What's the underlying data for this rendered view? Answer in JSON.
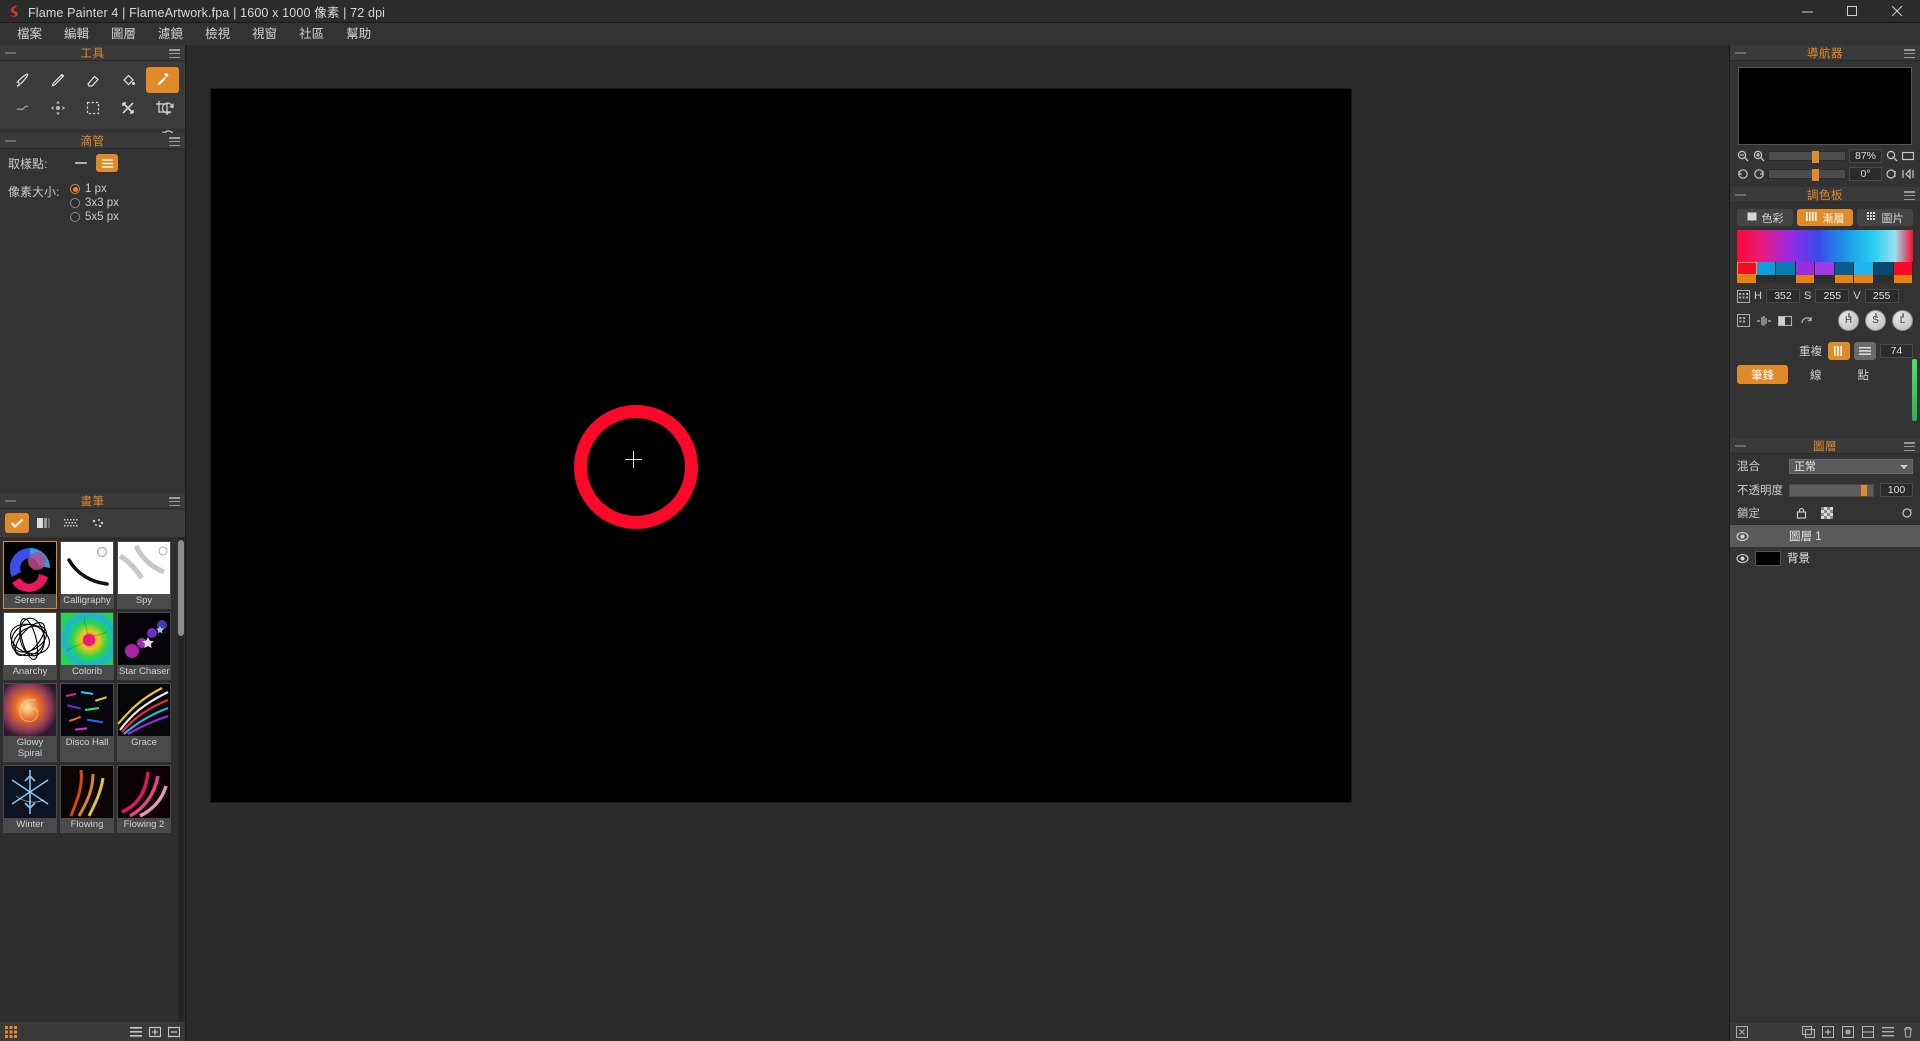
{
  "titlebar": {
    "title": "Flame Painter 4 | FlameArtwork.fpa | 1600 x 1000 像素 | 72 dpi",
    "logo_icon": "flame-logo-icon",
    "minimize_icon": "minimize-icon",
    "maximize_icon": "maximize-icon",
    "close_icon": "close-icon"
  },
  "menubar": {
    "items": [
      {
        "label": "檔案"
      },
      {
        "label": "編輯"
      },
      {
        "label": "圖層"
      },
      {
        "label": "濾鏡"
      },
      {
        "label": "檢視"
      },
      {
        "label": "視窗"
      },
      {
        "label": "社區"
      },
      {
        "label": "幫助"
      }
    ]
  },
  "tools_panel": {
    "title": "工具",
    "tools": [
      {
        "name": "brush-tool-icon",
        "selected": false
      },
      {
        "name": "pencil-tool-icon",
        "selected": false
      },
      {
        "name": "eraser-tool-icon",
        "selected": false
      },
      {
        "name": "paint-bucket-tool-icon",
        "selected": false
      },
      {
        "name": "eyedropper-tool-icon",
        "selected": true
      },
      {
        "name": "smudge-tool-icon",
        "selected": false
      },
      {
        "name": "transform-tool-icon",
        "selected": false
      },
      {
        "name": "rect-select-tool-icon",
        "selected": false
      },
      {
        "name": "move-tool-icon",
        "selected": false
      },
      {
        "name": "crop-tool-icon",
        "selected": false
      }
    ],
    "undo_icon": "undo-icon",
    "redo_icon": "redo-icon"
  },
  "eyedropper_panel": {
    "title": "滴管",
    "sample_point_label": "取樣點:",
    "sample_modes": [
      {
        "name": "sample-line-icon",
        "selected": false
      },
      {
        "name": "sample-layers-icon",
        "selected": true
      }
    ],
    "pixel_size_label": "像素大小:",
    "pixel_sizes": [
      {
        "label": "1 px",
        "selected": true
      },
      {
        "label": "3x3 px",
        "selected": false
      },
      {
        "label": "5x5 px",
        "selected": false
      }
    ]
  },
  "brush_panel": {
    "title": "畫筆",
    "tabs": [
      {
        "name": "brush-check-tab-icon",
        "selected": true
      },
      {
        "name": "brush-gradient-tab-icon",
        "selected": false
      },
      {
        "name": "brush-pattern-tab-icon",
        "selected": false
      },
      {
        "name": "brush-particle-tab-icon",
        "selected": false
      }
    ],
    "brushes": [
      {
        "label": "Serene",
        "selected": true,
        "thumb": "serene"
      },
      {
        "label": "Calligraphy",
        "selected": false,
        "thumb": "calligraphy"
      },
      {
        "label": "Spy",
        "selected": false,
        "thumb": "spy"
      },
      {
        "label": "Anarchy",
        "selected": false,
        "thumb": "anarchy"
      },
      {
        "label": "Colorib",
        "selected": false,
        "thumb": "colorib"
      },
      {
        "label": "Star Chasers",
        "selected": false,
        "thumb": "starchasers"
      },
      {
        "label": "Glowy Spiral",
        "selected": false,
        "thumb": "glowy"
      },
      {
        "label": "Disco Hall",
        "selected": false,
        "thumb": "disco"
      },
      {
        "label": "Grace",
        "selected": false,
        "thumb": "grace"
      },
      {
        "label": "Winter",
        "selected": false,
        "thumb": "winter"
      },
      {
        "label": "Flowing",
        "selected": false,
        "thumb": "flowing"
      },
      {
        "label": "Flowing 2",
        "selected": false,
        "thumb": "flowing2"
      }
    ],
    "bottom_icons": [
      {
        "name": "brush-grid-view-icon"
      },
      {
        "name": "brush-settings-icon"
      },
      {
        "name": "brush-import-icon"
      },
      {
        "name": "brush-delete-icon"
      }
    ]
  },
  "canvas": {
    "background_color": "#000000",
    "stroke_color": "#fa0a28",
    "cursor_icon": "crosshair-cursor-icon"
  },
  "navigator_panel": {
    "title": "導航器",
    "zoom_value": "87%",
    "rotate_value": "0°",
    "zoom_out_icon": "zoom-out-icon",
    "zoom_in_icon": "zoom-in-icon",
    "fit_icon": "fit-screen-icon",
    "actual_icon": "actual-size-icon",
    "rotate_left_icon": "rotate-left-icon",
    "rotate_right_icon": "rotate-right-icon",
    "flip_icon": "flip-icon",
    "reset_icon": "reset-view-icon"
  },
  "palette_panel": {
    "title": "調色板",
    "tabs": [
      {
        "label": "色彩",
        "icon": "color-swatch-icon",
        "selected": false
      },
      {
        "label": "漸層",
        "icon": "gradient-icon",
        "selected": true
      },
      {
        "label": "圖片",
        "icon": "image-grid-icon",
        "selected": false
      }
    ],
    "hsv": {
      "h_label": "H",
      "h_value": "352",
      "s_label": "S",
      "s_value": "255",
      "v_label": "V",
      "v_value": "255"
    },
    "swatches_top": [
      "#fa0826",
      "#0e9ede",
      "#0a7cb4",
      "#9a2ce0",
      "#a23ae8",
      "#0a5c8c",
      "#22b4f0",
      "#08486e",
      "#fa0826"
    ],
    "swatches_bottom": [
      "#e8820e",
      "#2e2e2e",
      "#2e2e2e",
      "#e8820e",
      "#2e2e2e",
      "#e8820e",
      "#e8820e",
      "#2e2e2e",
      "#e8820e"
    ],
    "selected_swatch_index": 0,
    "tool_icons": [
      {
        "name": "palette-grid-icon"
      },
      {
        "name": "palette-spread-icon"
      },
      {
        "name": "palette-invert-icon"
      },
      {
        "name": "palette-loop-icon"
      }
    ],
    "knobs": [
      {
        "label": "H"
      },
      {
        "label": "S"
      },
      {
        "label": "L"
      }
    ],
    "repeat_label": "重複",
    "repeat_value": "74",
    "repeat_modes": [
      {
        "name": "repeat-bars-icon",
        "selected": true
      },
      {
        "name": "repeat-lines-icon",
        "selected": false
      }
    ],
    "mode_buttons": [
      {
        "label": "筆鋒",
        "selected": true
      },
      {
        "label": "線",
        "selected": false
      },
      {
        "label": "點",
        "selected": false
      }
    ]
  },
  "layers_panel": {
    "title": "圖層",
    "blend_label": "混合",
    "blend_value": "正常",
    "opacity_label": "不透明度",
    "opacity_value": "100",
    "lock_label": "鎖定",
    "lock_icons": [
      {
        "name": "lock-transparency-icon"
      },
      {
        "name": "lock-checker-icon"
      },
      {
        "name": "lock-alpha-icon"
      }
    ],
    "layers": [
      {
        "name": "圖層 1",
        "visible": true,
        "selected": true,
        "has_thumb": false
      },
      {
        "name": "背景",
        "visible": true,
        "selected": false,
        "has_thumb": true
      }
    ],
    "bottom_icons": [
      {
        "name": "layer-close-icon"
      },
      {
        "name": "layer-duplicate-icon"
      },
      {
        "name": "layer-add-icon"
      },
      {
        "name": "layer-group-icon"
      },
      {
        "name": "layer-mask-icon"
      },
      {
        "name": "layer-merge-icon"
      },
      {
        "name": "layer-delete-icon"
      }
    ]
  }
}
